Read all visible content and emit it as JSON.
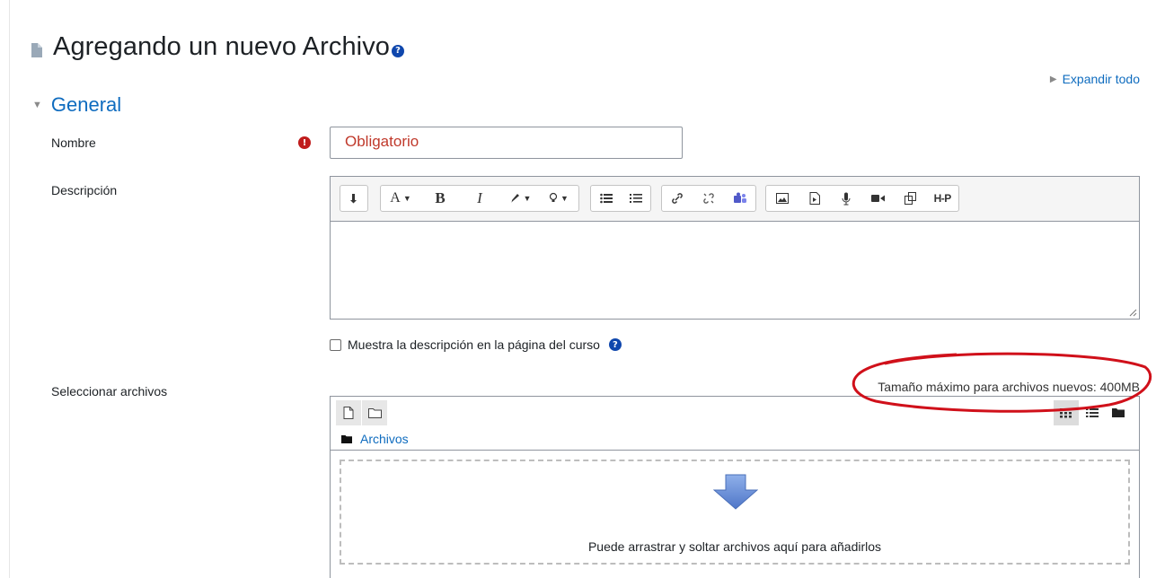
{
  "header": {
    "title": "Agregando un nuevo Archivo"
  },
  "expand_all": "Expandir todo",
  "section": {
    "title": "General"
  },
  "fields": {
    "name_label": "Nombre",
    "name_value": "Obligatorio",
    "description_label": "Descripción",
    "show_description_label": "Muestra la descripción en la página del curso",
    "select_files_label": "Seleccionar archivos"
  },
  "toolbar": {
    "groups": [
      {
        "icons": [
          "collapse-icon"
        ]
      },
      {
        "icons": [
          "font-style-icon",
          "bold-icon",
          "italic-icon",
          "text-color-icon",
          "highlight-icon"
        ]
      },
      {
        "icons": [
          "unordered-list-icon",
          "ordered-list-icon"
        ]
      },
      {
        "icons": [
          "link-icon",
          "unlink-icon",
          "teams-meeting-icon"
        ]
      },
      {
        "icons": [
          "image-icon",
          "media-icon",
          "record-audio-icon",
          "record-video-icon",
          "manage-files-icon",
          "h5p-icon"
        ]
      }
    ],
    "labels": {
      "bold": "B",
      "italic": "I",
      "font": "A",
      "h5p": "H-P"
    }
  },
  "filemanager": {
    "max_size": "Tamaño máximo para archivos nuevos: 400MB",
    "path_folder": "Archivos",
    "drop_text": "Puede arrastrar y soltar archivos aquí para añadirlos"
  },
  "colors": {
    "accent": "#0f6cbf",
    "required": "#c01c1c",
    "annotation": "#d0101a",
    "drop_arrow": "#6a8ed8"
  }
}
